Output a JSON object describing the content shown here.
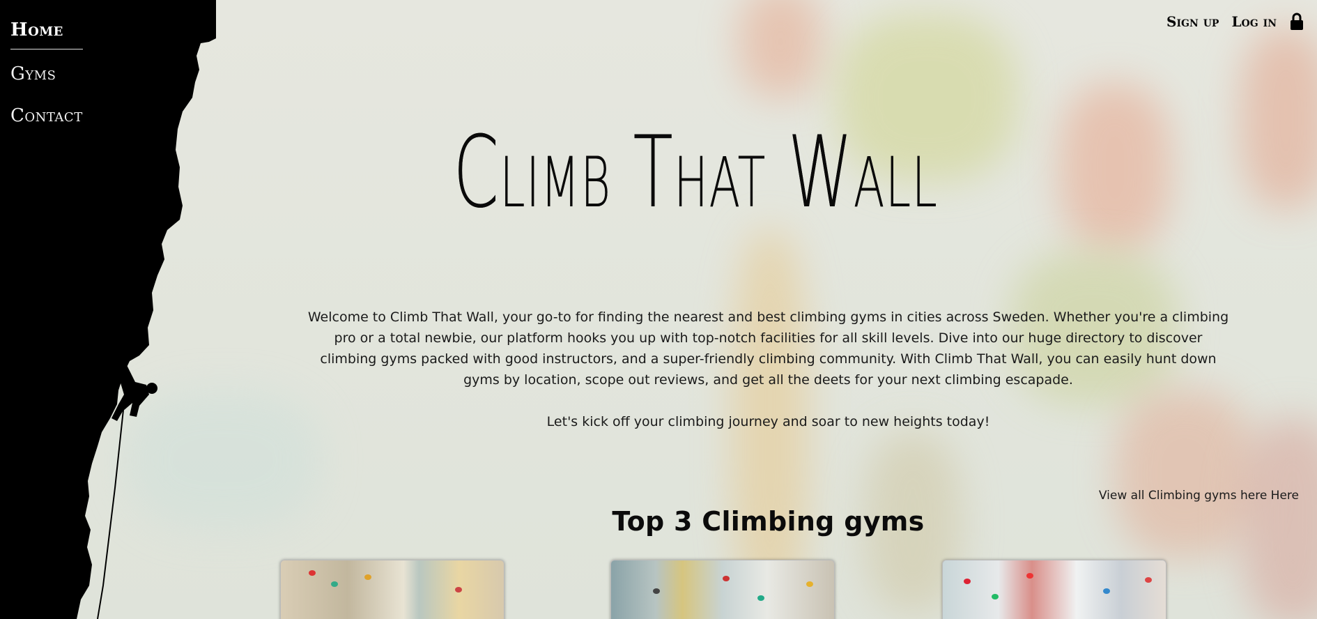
{
  "nav": {
    "items": [
      {
        "label": "Home",
        "active": true
      },
      {
        "label": "Gyms",
        "active": false
      },
      {
        "label": "Contact",
        "active": false
      }
    ]
  },
  "account": {
    "signup_label": "Sign up",
    "login_label": "Log in",
    "icon": "lock-icon"
  },
  "hero": {
    "title": "Climb That Wall",
    "intro": "Welcome to Climb That Wall, your go-to for finding the nearest and best climbing gyms in cities across Sweden. Whether you're a climbing pro or a total newbie, our platform hooks you up with top-notch facilities for all skill levels. Dive into our huge directory to discover climbing gyms packed with good instructors, and a super-friendly climbing community. With Climb That Wall, you can easily hunt down gyms by location, scope out reviews, and get all the deets for your next climbing escapade.",
    "cta_text": "Let's kick off your climbing journey and soar to new heights today!"
  },
  "gyms": {
    "view_all_label": "View all Climbing gyms here Here",
    "section_title": "Top 3 Climbing gyms"
  }
}
